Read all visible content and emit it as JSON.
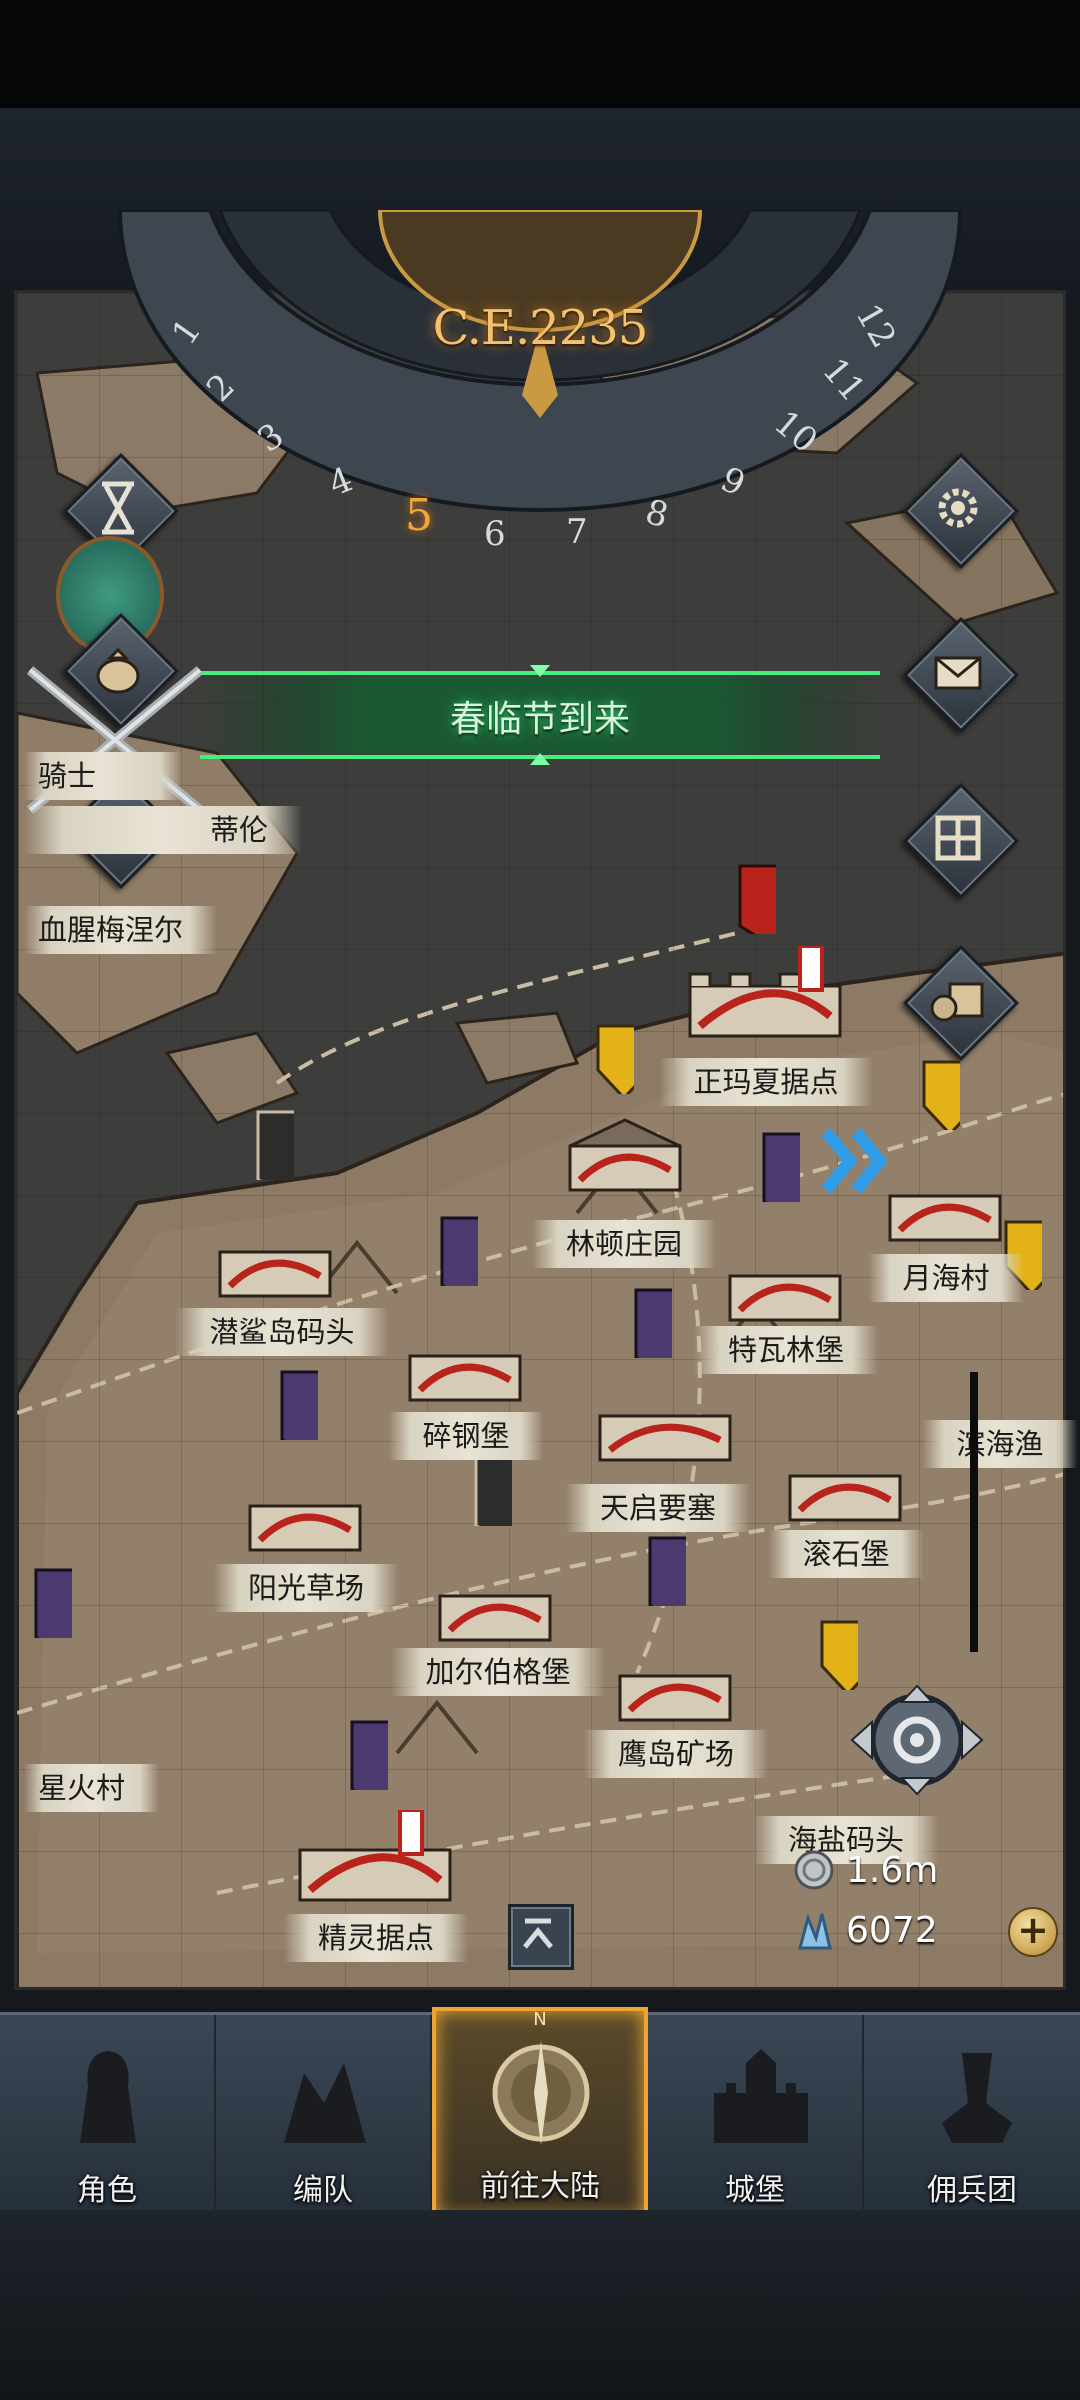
{
  "calendar": {
    "year": "C.E.2235",
    "current_month": "5",
    "months": [
      "1",
      "2",
      "3",
      "4",
      "5",
      "6",
      "7",
      "8",
      "9",
      "10",
      "11",
      "12"
    ]
  },
  "event": {
    "text": "春临节到来"
  },
  "left_labels": {
    "knight": "骑士",
    "lun": "蒂伦",
    "blood": "血腥梅涅尔"
  },
  "locations": [
    {
      "name": "正玛夏据点"
    },
    {
      "name": "林顿庄园"
    },
    {
      "name": "月海村"
    },
    {
      "name": "潜鲨岛码头"
    },
    {
      "name": "特瓦林堡"
    },
    {
      "name": "碎钢堡"
    },
    {
      "name": "滨海渔"
    },
    {
      "name": "天启要塞"
    },
    {
      "name": "滚石堡"
    },
    {
      "name": "阳光草场"
    },
    {
      "name": "加尔伯格堡"
    },
    {
      "name": "鹰岛矿场"
    },
    {
      "name": "星火村"
    },
    {
      "name": "海盐码头"
    },
    {
      "name": "精灵据点"
    }
  ],
  "resources": {
    "silver": "1.6m",
    "crystal": "6072"
  },
  "nav": {
    "tabs": [
      {
        "label": "角色",
        "icon": "knight-icon"
      },
      {
        "label": "编队",
        "icon": "formation-icon"
      },
      {
        "label": "前往大陆",
        "icon": "compass-icon",
        "active": true
      },
      {
        "label": "城堡",
        "icon": "castle-icon"
      },
      {
        "label": "佣兵团",
        "icon": "mercenary-icon"
      }
    ],
    "compass_mark": "N"
  },
  "colors": {
    "event_glow": "#2fd36a",
    "year_gold": "#f3c271",
    "active_tab_border": "#f0a532",
    "route_blue": "#2f9de8",
    "enemy_banner": "#4b3a6e",
    "gold_shield": "#e3b218",
    "red_flag": "#b8231c"
  }
}
